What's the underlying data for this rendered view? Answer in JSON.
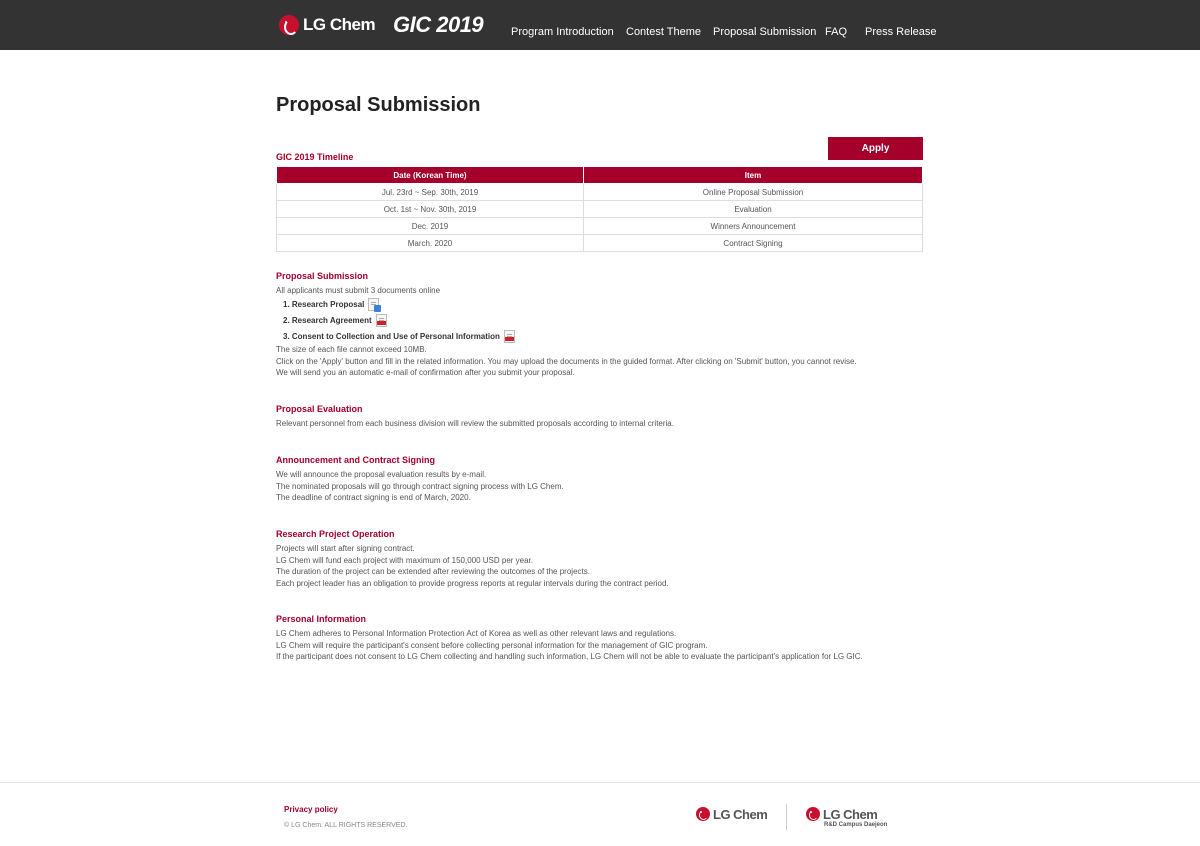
{
  "header": {
    "brand": "LG Chem",
    "contest_logo": "GIC 2019",
    "nav": [
      {
        "label": "Program Introduction"
      },
      {
        "label": "Contest Theme"
      },
      {
        "label": "Proposal Submission"
      },
      {
        "label": "FAQ"
      },
      {
        "label": "Press Release"
      }
    ]
  },
  "page": {
    "title": "Proposal Submission",
    "apply_label": "Apply"
  },
  "timeline": {
    "title": "GIC 2019 Timeline",
    "columns": [
      "Date (Korean Time)",
      "Item"
    ],
    "rows": [
      [
        "Jul. 23rd ~ Sep. 30th, 2019",
        "Online Proposal Submission"
      ],
      [
        "Oct. 1st ~ Nov. 30th, 2019",
        "Evaluation"
      ],
      [
        "Dec. 2019",
        "Winners Announcement"
      ],
      [
        "March. 2020",
        "Contract Signing"
      ]
    ]
  },
  "submission": {
    "title": "Proposal Submission",
    "intro": "All applicants must submit 3 documents online",
    "documents": [
      {
        "label": "1. Research Proposal",
        "icon": "word-document-icon"
      },
      {
        "label": "2. Research Agreement",
        "icon": "pdf-document-icon"
      },
      {
        "label": "3. Consent to Collection and Use of Personal Information",
        "icon": "pdf-document-icon"
      }
    ],
    "notes": [
      "The size of each file cannot exceed 10MB.",
      "Click on the 'Apply' button and fill in the related information. You may upload the documents in the guided format. After clicking on 'Submit' button, you cannot revise.",
      "We will send you an automatic e-mail of confirmation after you submit your proposal."
    ]
  },
  "evaluation": {
    "title": "Proposal Evaluation",
    "lines": [
      "Relevant personnel from each business division will review the submitted proposals according to internal criteria."
    ]
  },
  "announcement": {
    "title": "Announcement and Contract Signing",
    "lines": [
      "We will announce the proposal evaluation results by e-mail.",
      "The nominated proposals will go through contract signing process with LG Chem.",
      "The deadline of contract signing is end of March, 2020."
    ]
  },
  "operation": {
    "title": "Research Project Operation",
    "lines": [
      "Projects will start after signing contract.",
      "LG Chem will fund each project with maximum of 150,000 USD per year.",
      "The duration of the project can be extended after reviewing the outcomes of the projects.",
      "Each project leader has an obligation to provide progress reports at regular intervals during the contract period."
    ]
  },
  "personal": {
    "title": "Personal Information",
    "lines": [
      "LG Chem adheres to Personal Information Protection Act of Korea as well as other relevant laws and regulations.",
      "LG Chem will require the participant's consent before collecting personal information for the management of GIC program.",
      "If the participant does not consent to LG Chem collecting and handling such information, LG Chem will not be able to evaluate the participant's application for LG GIC."
    ]
  },
  "footer": {
    "privacy": "Privacy policy",
    "copyright": "© LG Chem. ALL RIGHTS RESERVED.",
    "logo1": "LG Chem",
    "logo2": "LG Chem",
    "logo2_sub": "R&D Campus Daejeon"
  },
  "colors": {
    "brand_red": "#a5002c",
    "header_bg": "#333333"
  }
}
